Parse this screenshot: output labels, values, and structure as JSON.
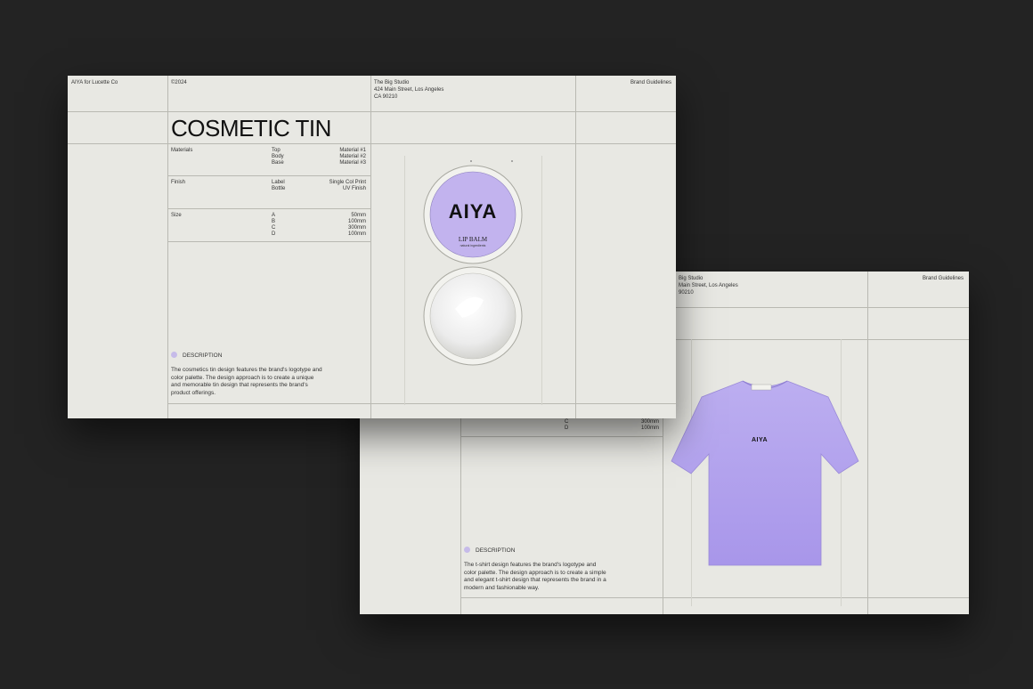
{
  "colors": {
    "background": "#232323",
    "slide": "#e8e8e3",
    "accent_lavender": "#b7a9ea",
    "lid_lavender": "#c2b3ee"
  },
  "back_slide": {
    "header": {
      "studio_partial": "Big Studio",
      "address_partial": "Main Street, Los Angeles",
      "zip_partial": "90210",
      "doc_label": "Brand Guidelines"
    },
    "size_rows": [
      {
        "code": "C",
        "value": "300mm"
      },
      {
        "code": "D",
        "value": "100mm"
      }
    ],
    "shirt_logo": "AIYA",
    "description_heading": "DESCRIPTION",
    "description_lines": [
      "The t-shirt design features the brand's logotype and",
      "color palette. The design approach is to create a simple",
      "and elegant t-shirt design that represents the brand in a",
      "modern and fashionable way."
    ]
  },
  "front_slide": {
    "header": {
      "client": "AIYA for Lucette Co",
      "year": "©2024",
      "studio": "The Big Studio",
      "address": "424 Main Street, Los Angeles",
      "zip": "CA 90210",
      "doc_label": "Brand Guidelines"
    },
    "title": "COSMETIC TIN",
    "specs": [
      {
        "label": "Materials",
        "keys": [
          "Top",
          "Body",
          "Base"
        ],
        "values": [
          "Material #1",
          "Material #2",
          "Material #3"
        ]
      },
      {
        "label": "Finish",
        "keys": [
          "Label",
          "Bottle"
        ],
        "values": [
          "Single Col Print",
          "UV Finish"
        ]
      },
      {
        "label": "Size",
        "keys": [
          "A",
          "B",
          "C",
          "D"
        ],
        "values": [
          "50mm",
          "100mm",
          "300mm",
          "100mm"
        ]
      }
    ],
    "tin": {
      "logo": "AIYA",
      "product": "LIP BALM",
      "fine_print": "natural ingredients"
    },
    "description_heading": "DESCRIPTION",
    "description_lines": [
      "The cosmetics tin design features the brand's logotype and",
      "color palette. The design approach is to create a unique",
      "and memorable tin design that represents the brand's",
      "product offerings."
    ]
  }
}
